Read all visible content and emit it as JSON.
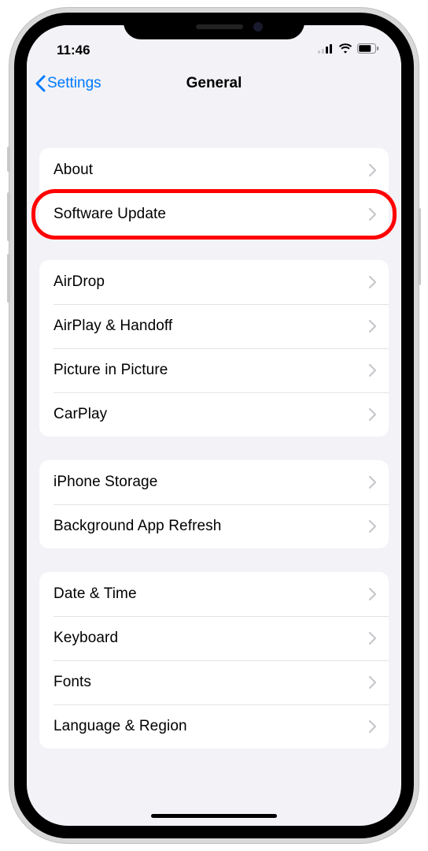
{
  "status": {
    "time": "11:46"
  },
  "nav": {
    "back": "Settings",
    "title": "General"
  },
  "groups": [
    {
      "rows": [
        {
          "label": "About"
        },
        {
          "label": "Software Update",
          "highlighted": true
        }
      ]
    },
    {
      "rows": [
        {
          "label": "AirDrop"
        },
        {
          "label": "AirPlay & Handoff"
        },
        {
          "label": "Picture in Picture"
        },
        {
          "label": "CarPlay"
        }
      ]
    },
    {
      "rows": [
        {
          "label": "iPhone Storage"
        },
        {
          "label": "Background App Refresh"
        }
      ]
    },
    {
      "rows": [
        {
          "label": "Date & Time"
        },
        {
          "label": "Keyboard"
        },
        {
          "label": "Fonts"
        },
        {
          "label": "Language & Region"
        }
      ]
    }
  ]
}
